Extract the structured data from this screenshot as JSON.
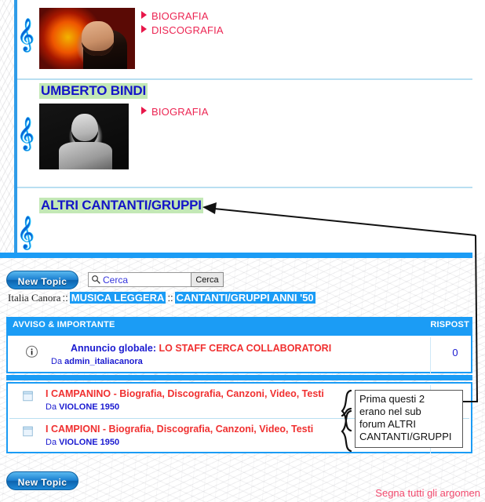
{
  "singers_panel": {
    "entries": [
      {
        "name": "",
        "photo": "photo-color-singer",
        "links": [
          "BIOGRAFIA",
          "DISCOGRAFIA"
        ]
      },
      {
        "name": "UMBERTO BINDI",
        "photo": "photo-bw-singer",
        "links": [
          "BIOGRAFIA"
        ]
      },
      {
        "name": "ALTRI CANTANTI/GRUPPI",
        "photo": "",
        "links": []
      }
    ],
    "clef_icon": "Ʃ"
  },
  "forum": {
    "new_topic_label": "New Topic",
    "new_topic_label_bottom": "New Topic",
    "search": {
      "placeholder": "Cerca",
      "value": "",
      "button_label": "Cerca",
      "icon": "search-icon"
    },
    "breadcrumb": {
      "root": "Italia Canora",
      "separator": "::",
      "links": [
        "MUSICA LEGGERA",
        "CANTANTI/GRUPPI ANNI '50"
      ]
    },
    "table": {
      "header_title": "AVVISO & IMPORTANTE",
      "header_replies": "RISPOST",
      "announcement": {
        "icon": "info-icon",
        "prefix": "Annuncio globale:",
        "title": "LO STAFF CERCA COLLABORATORI",
        "by_label": "Da",
        "author": "admin_italiacanora",
        "replies": "0"
      },
      "topics": [
        {
          "icon": "document-icon",
          "title": "I CAMPANINO - Biografia, Discografia, Canzoni, Video, Testi",
          "by_label": "Da",
          "author": "VIOLONE 1950"
        },
        {
          "icon": "document-icon",
          "title": "I CAMPIONI - Biografia, Discografia, Canzoni, Video, Testi",
          "by_label": "Da",
          "author": "VIOLONE 1950"
        }
      ]
    },
    "mark_all_read": "Segna tutti gli argomen"
  },
  "annotation": {
    "text_lines": [
      "Prima questi 2",
      "erano nel sub",
      "forum ALTRI",
      "CANTANTI/GRUPPI"
    ],
    "full_text": "Prima questi 2 erano nel sub forum ALTRI CANTANTI/GRUPPI"
  },
  "colors": {
    "accent_blue": "#1b9cf5",
    "link_red": "#ec2653",
    "title_blue": "#1414c8",
    "highlight_green": "#c3e8b6",
    "topic_red": "#f03030",
    "mark_read_pink": "#f24a6e"
  }
}
